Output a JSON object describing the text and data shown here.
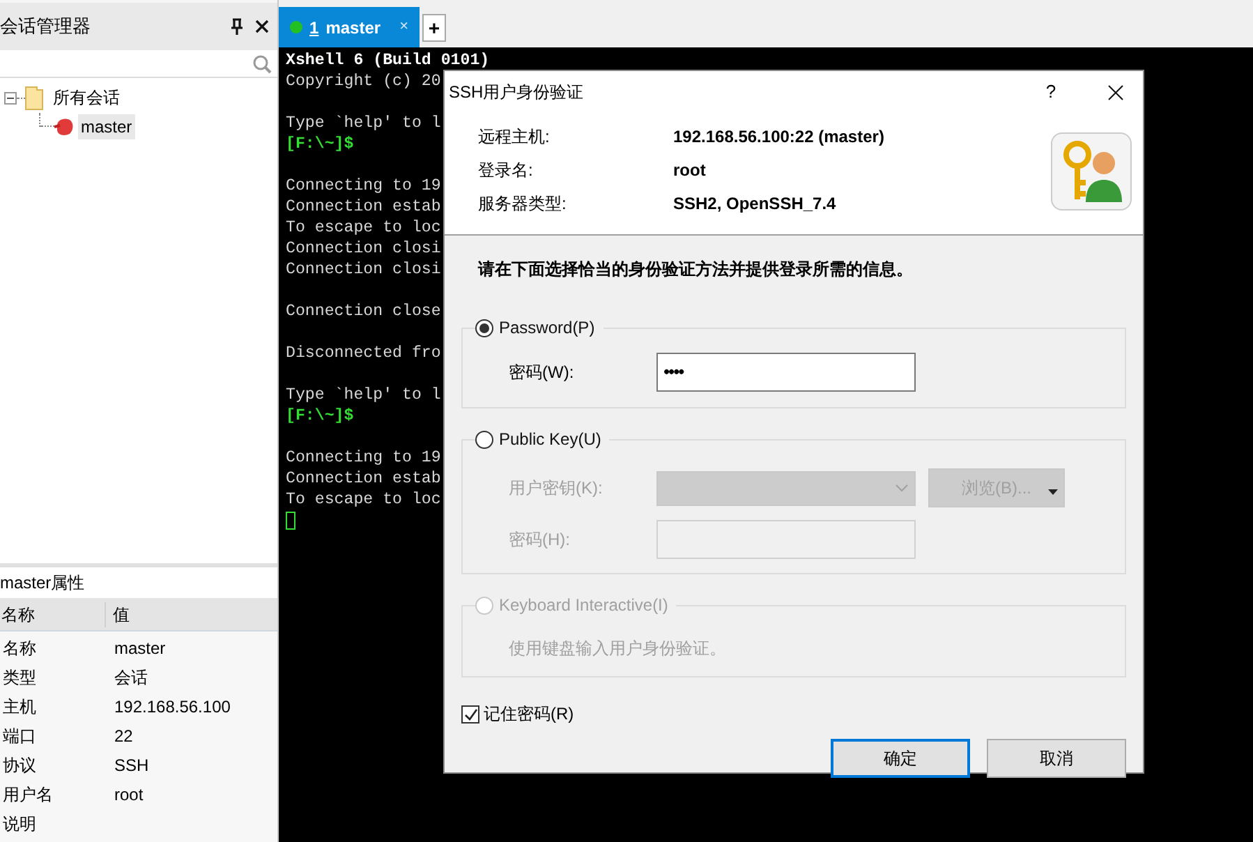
{
  "session_manager": {
    "title": "会话管理器",
    "tree": [
      {
        "label": "所有会话",
        "expanded": true,
        "children": [
          {
            "label": "master",
            "selected": true
          }
        ]
      }
    ]
  },
  "properties": {
    "title": "master属性",
    "columns": [
      "名称",
      "值"
    ],
    "rows": [
      [
        "名称",
        "master"
      ],
      [
        "类型",
        "会话"
      ],
      [
        "主机",
        "192.168.56.100"
      ],
      [
        "端口",
        "22"
      ],
      [
        "协议",
        "SSH"
      ],
      [
        "用户名",
        "root"
      ],
      [
        "说明",
        ""
      ]
    ]
  },
  "tabs": [
    {
      "number": "1",
      "label": "master",
      "selected": true,
      "connected": true,
      "close": "×"
    }
  ],
  "new_tab": "+",
  "terminal": [
    {
      "kind": "bold",
      "text": "Xshell 6 (Build 0101)"
    },
    {
      "kind": "text",
      "text": "Copyright (c) 20"
    },
    {
      "kind": "blank"
    },
    {
      "kind": "text",
      "text": "Type `help' to l"
    },
    {
      "kind": "prompt",
      "text": "[F:\\~]$"
    },
    {
      "kind": "blank"
    },
    {
      "kind": "text",
      "text": "Connecting to 19"
    },
    {
      "kind": "text",
      "text": "Connection estab"
    },
    {
      "kind": "text",
      "text": "To escape to loc"
    },
    {
      "kind": "text",
      "text": "Connection closi"
    },
    {
      "kind": "text",
      "text": "Connection closi"
    },
    {
      "kind": "blank"
    },
    {
      "kind": "text",
      "text": "Connection close"
    },
    {
      "kind": "blank"
    },
    {
      "kind": "text",
      "text": "Disconnected fro"
    },
    {
      "kind": "blank"
    },
    {
      "kind": "text",
      "text": "Type `help' to l"
    },
    {
      "kind": "prompt",
      "text": "[F:\\~]$"
    },
    {
      "kind": "blank"
    },
    {
      "kind": "text",
      "text": "Connecting to 19"
    },
    {
      "kind": "text",
      "text": "Connection estab"
    },
    {
      "kind": "text",
      "text": "To escape to loc"
    },
    {
      "kind": "cursor"
    }
  ],
  "dialog": {
    "title": "SSH用户身份验证",
    "help": "?",
    "info": [
      {
        "label": "远程主机:",
        "value": "192.168.56.100:22 (master)"
      },
      {
        "label": "登录名:",
        "value": "root"
      },
      {
        "label": "服务器类型:",
        "value": "SSH2, OpenSSH_7.4"
      }
    ],
    "instruction": "请在下面选择恰当的身份验证方法并提供登录所需的信息。",
    "methods": [
      {
        "label": "Password(P)",
        "selected": true,
        "disabled": false,
        "kind": "password",
        "field_label": "密码(W):",
        "value": "••••"
      },
      {
        "label": "Public Key(U)",
        "selected": false,
        "disabled": false,
        "kind": "publickey",
        "key_label": "用户密钥(K):",
        "browse": "浏览(B)...",
        "passphrase_label": "密码(H):"
      },
      {
        "label": "Keyboard Interactive(I)",
        "selected": false,
        "disabled": true,
        "kind": "keyboard",
        "description": "使用键盘输入用户身份验证。"
      }
    ],
    "remember": {
      "label": "记住密码(R)",
      "checked": true
    },
    "buttons": [
      {
        "label": "确定",
        "default": true
      },
      {
        "label": "取消",
        "default": false
      }
    ]
  }
}
